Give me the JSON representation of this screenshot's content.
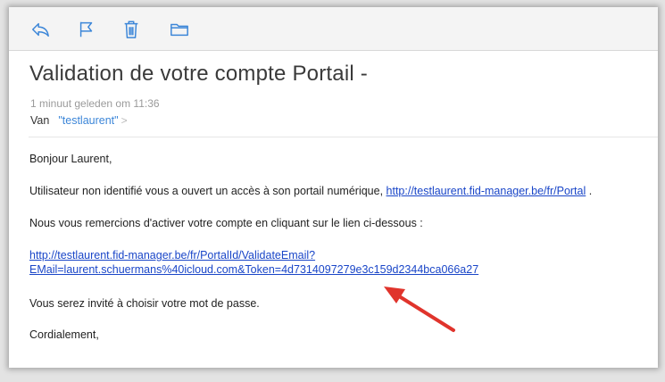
{
  "toolbar": {
    "buttons": [
      {
        "name": "reply",
        "icon": "reply-icon"
      },
      {
        "name": "flag",
        "icon": "flag-icon"
      },
      {
        "name": "trash",
        "icon": "trash-icon"
      },
      {
        "name": "move",
        "icon": "folder-icon"
      }
    ],
    "icon_color": "#3c86d8"
  },
  "message": {
    "subject": "Validation de votre compte Portail -",
    "time": "1 minuut geleden om 11:36",
    "from_label": "Van",
    "sender": "\"testlaurent\"",
    "sender_chevron": ">",
    "greeting": "Bonjour Laurent,",
    "line1_text": "Utilisateur non identifié vous a ouvert un accès à son portail numérique, ",
    "line1_link": "http://testlaurent.fid-manager.be/fr/Portal",
    "line1_end": " .",
    "line2": "Nous vous remercions d'activer votre compte en cliquant sur le lien ci-dessous :",
    "validation_link_1": "http://testlaurent.fid-manager.be/fr/PortalId/ValidateEmail?",
    "validation_link_2": "EMail=laurent.schuermans%40icloud.com&Token=4d7314097279e3c159d2344bca066a27",
    "line3": "Vous serez invité à choisir votre mot de passe.",
    "closing": "Cordialement,"
  },
  "annotation": {
    "arrow_color": "#e0342c"
  }
}
